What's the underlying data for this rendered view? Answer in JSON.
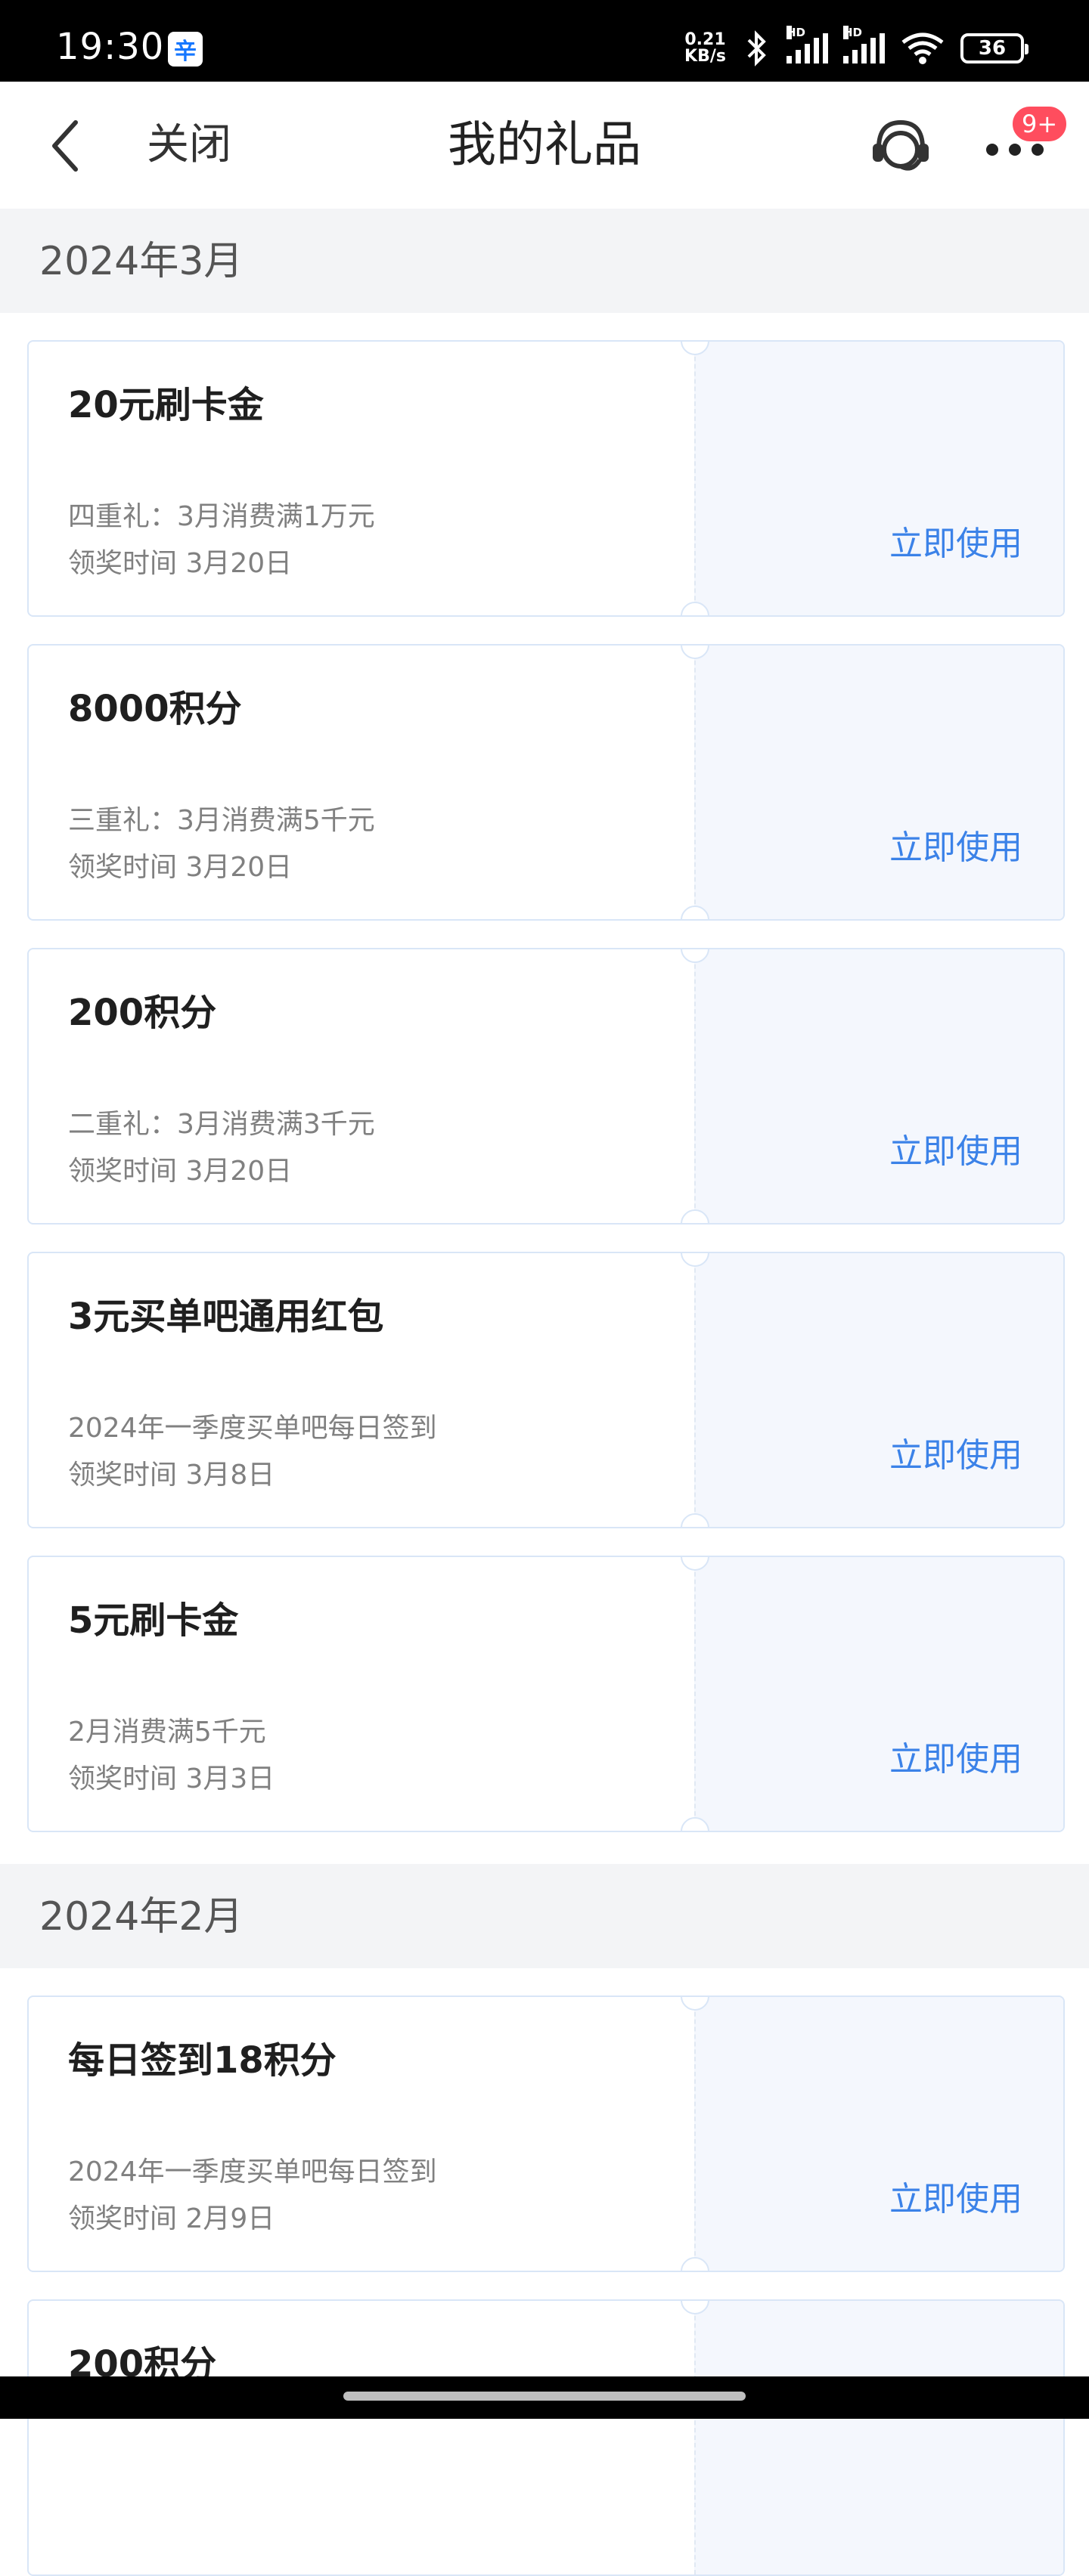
{
  "status_bar": {
    "time": "19:30",
    "app_icon_glyph": "辛",
    "net_speed_value": "0.21",
    "net_speed_unit": "KB/s",
    "signal_label": "HD",
    "battery": "36"
  },
  "navbar": {
    "close_label": "关闭",
    "title": "我的礼品",
    "badge": "9+"
  },
  "sections": [
    {
      "month": "2024年3月",
      "gifts": [
        {
          "name": "20元刷卡金",
          "desc": "四重礼：3月消费满1万元",
          "time": "领奖时间 3月20日",
          "action": "立即使用"
        },
        {
          "name": "8000积分",
          "desc": "三重礼：3月消费满5千元",
          "time": "领奖时间 3月20日",
          "action": "立即使用"
        },
        {
          "name": "200积分",
          "desc": "二重礼：3月消费满3千元",
          "time": "领奖时间 3月20日",
          "action": "立即使用"
        },
        {
          "name": "3元买单吧通用红包",
          "desc": "2024年一季度买单吧每日签到",
          "time": "领奖时间 3月8日",
          "action": "立即使用"
        },
        {
          "name": "5元刷卡金",
          "desc": "2月消费满5千元",
          "time": "领奖时间 3月3日",
          "action": "立即使用"
        }
      ]
    },
    {
      "month": "2024年2月",
      "gifts": [
        {
          "name": "每日签到18积分",
          "desc": "2024年一季度买单吧每日签到",
          "time": "领奖时间 2月9日",
          "action": "立即使用"
        },
        {
          "name": "200积分"
        }
      ]
    }
  ],
  "colors": {
    "accent": "#3b82e8",
    "badge": "#ff4d5e",
    "section_bg": "#f3f4f6"
  }
}
